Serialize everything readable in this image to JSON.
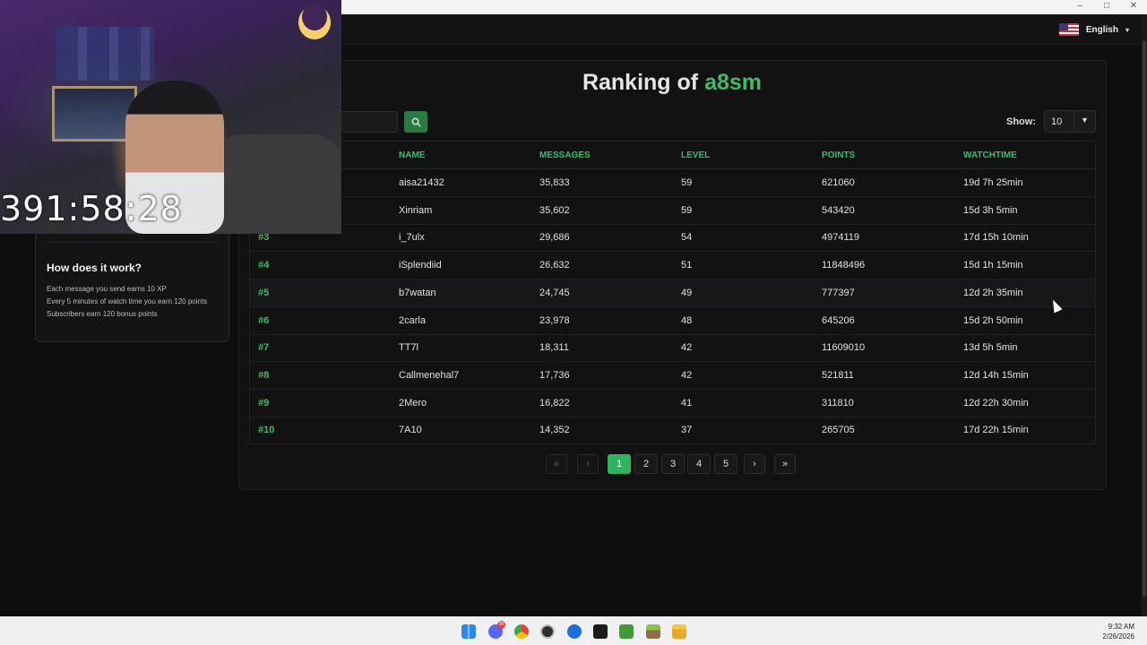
{
  "webcam": {
    "timer": "391:58:28"
  },
  "nav": {
    "language": "English"
  },
  "sidebar": {
    "heading": "How does it work?",
    "lines": [
      "Each message you send earns 10 XP",
      "Every 5 minutes of watch time you earn 120 points",
      "Subscribers earn 120 bonus points"
    ]
  },
  "ranking": {
    "title_prefix": "Ranking of",
    "channel": "a8sm",
    "show_label": "Show:",
    "show_value": "10",
    "columns": [
      "NAME",
      "MESSAGES",
      "LEVEL",
      "POINTS",
      "WATCHTIME"
    ],
    "rows": [
      {
        "rank": "",
        "name": "aisa21432",
        "messages": "35,833",
        "level": "59",
        "points": "621060",
        "watchtime": "19d 7h 25min"
      },
      {
        "rank": "",
        "name": "Xinriam",
        "messages": "35,602",
        "level": "59",
        "points": "543420",
        "watchtime": "15d 3h 5min"
      },
      {
        "rank": "#3",
        "name": "i_7ulx",
        "messages": "29,686",
        "level": "54",
        "points": "4974119",
        "watchtime": "17d 15h 10min"
      },
      {
        "rank": "#4",
        "name": "iSplendiid",
        "messages": "26,632",
        "level": "51",
        "points": "11848496",
        "watchtime": "15d 1h 15min"
      },
      {
        "rank": "#5",
        "name": "b7watan",
        "messages": "24,745",
        "level": "49",
        "points": "777397",
        "watchtime": "12d 2h 35min"
      },
      {
        "rank": "#6",
        "name": "2carla",
        "messages": "23,978",
        "level": "48",
        "points": "645206",
        "watchtime": "15d 2h 50min"
      },
      {
        "rank": "#7",
        "name": "TT7l",
        "messages": "18,311",
        "level": "42",
        "points": "11609010",
        "watchtime": "13d 5h 5min"
      },
      {
        "rank": "#8",
        "name": "Callmenehal7",
        "messages": "17,736",
        "level": "42",
        "points": "521811",
        "watchtime": "12d 14h 15min"
      },
      {
        "rank": "#9",
        "name": "2Mero",
        "messages": "16,822",
        "level": "41",
        "points": "311810",
        "watchtime": "12d 22h 30min"
      },
      {
        "rank": "#10",
        "name": "7A10",
        "messages": "14,352",
        "level": "37",
        "points": "265705",
        "watchtime": "17d 22h 15min"
      }
    ]
  },
  "pagination": {
    "first": "«",
    "prev": "‹",
    "pages": [
      "1",
      "2",
      "3",
      "4",
      "5"
    ],
    "current": "1",
    "next": "›",
    "last": "»"
  },
  "taskbar": {
    "time": "9:32 AM",
    "date": "2/26/2026",
    "discord_badge": "99",
    "icons": [
      "windows-start-icon",
      "discord-icon",
      "chrome-icon",
      "obs-icon",
      "browser-icon",
      "app-icon",
      "minecraft-icon",
      "game-launcher-icon",
      "file-explorer-icon"
    ]
  }
}
